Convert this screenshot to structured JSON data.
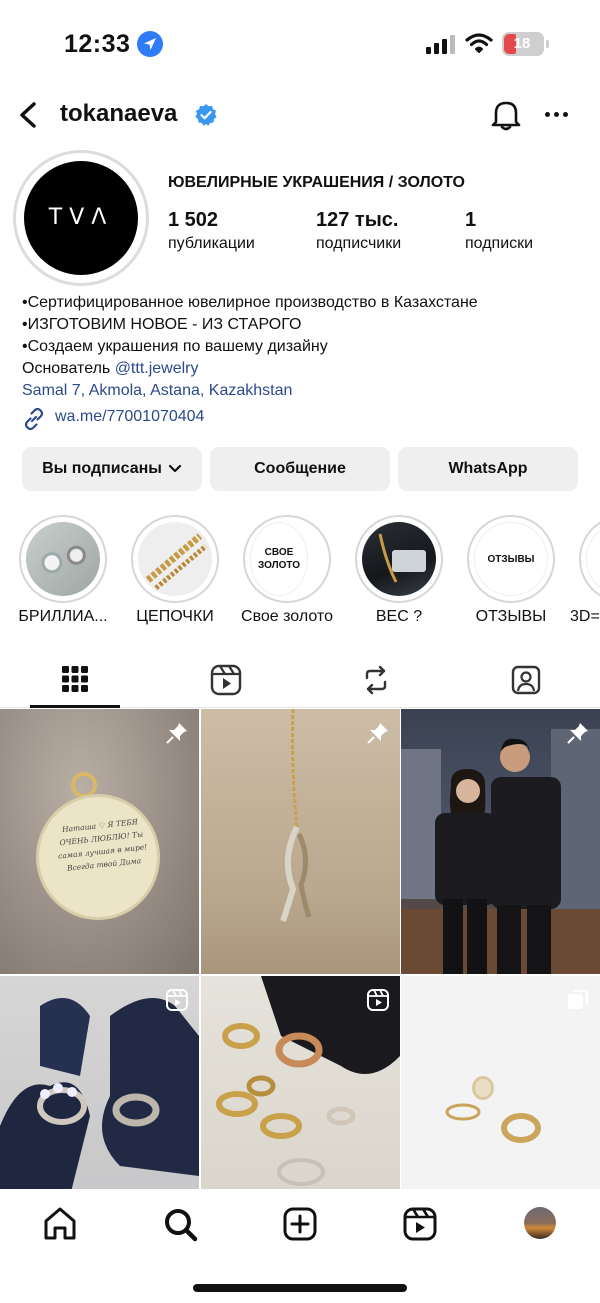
{
  "status_bar": {
    "time": "12:33",
    "battery": "18"
  },
  "header": {
    "username": "tokanaeva"
  },
  "profile": {
    "avatar_text": "TVΛ",
    "category": "ЮВЕЛИРНЫЕ УКРАШЕНИЯ / ЗОЛОТО",
    "stats": [
      {
        "value": "1 502",
        "label": "публикации"
      },
      {
        "value": "127 тыс.",
        "label": "подписчики"
      },
      {
        "value": "1",
        "label": "подписки"
      }
    ],
    "bio": {
      "line1": "•Сертифицированное ювелирное производство в Казахстане",
      "line2": "•ИЗГОТОВИМ НОВОЕ - ИЗ СТАРОГО",
      "line3": "•Создаем украшения по вашему дизайну",
      "founder_prefix": "Основатель",
      "founder_handle": "@ttt.jewelry",
      "location": "Samal 7, Akmola, Astana, Kazakhstan"
    },
    "link": "wa.me/77001070404"
  },
  "buttons": {
    "following": "Вы подписаны",
    "message": "Сообщение",
    "whatsapp": "WhatsApp"
  },
  "highlights": [
    {
      "label": "БРИЛЛИА...",
      "inner_text": ""
    },
    {
      "label": "ЦЕПОЧКИ",
      "inner_text": ""
    },
    {
      "label": "Свое золото",
      "inner_text": "СВОЕ ЗОЛОТО"
    },
    {
      "label": "ВЕС ?",
      "inner_text": ""
    },
    {
      "label": "ОТЗЫВЫ",
      "inner_text": "ОТЗЫВЫ"
    },
    {
      "label": "3D=",
      "inner_text": ""
    }
  ],
  "tabs": [
    "grid-tab",
    "reels-tab",
    "reposts-tab",
    "tagged-tab"
  ],
  "grid_posts": [
    {
      "type": "pinned",
      "engraving": "Наташа ♡ Я ТЕБЯ ОЧЕНЬ ЛЮБЛЮ! Ты самая лучшая в мире! Всегда твой Дима"
    },
    {
      "type": "pinned"
    },
    {
      "type": "pinned"
    },
    {
      "type": "reel"
    },
    {
      "type": "reel"
    },
    {
      "type": "carousel"
    }
  ],
  "colors": {
    "link": "#2c4a8b",
    "button_bg": "#efefef",
    "verified": "#3897f0",
    "location_badge": "#2f7cf6"
  }
}
